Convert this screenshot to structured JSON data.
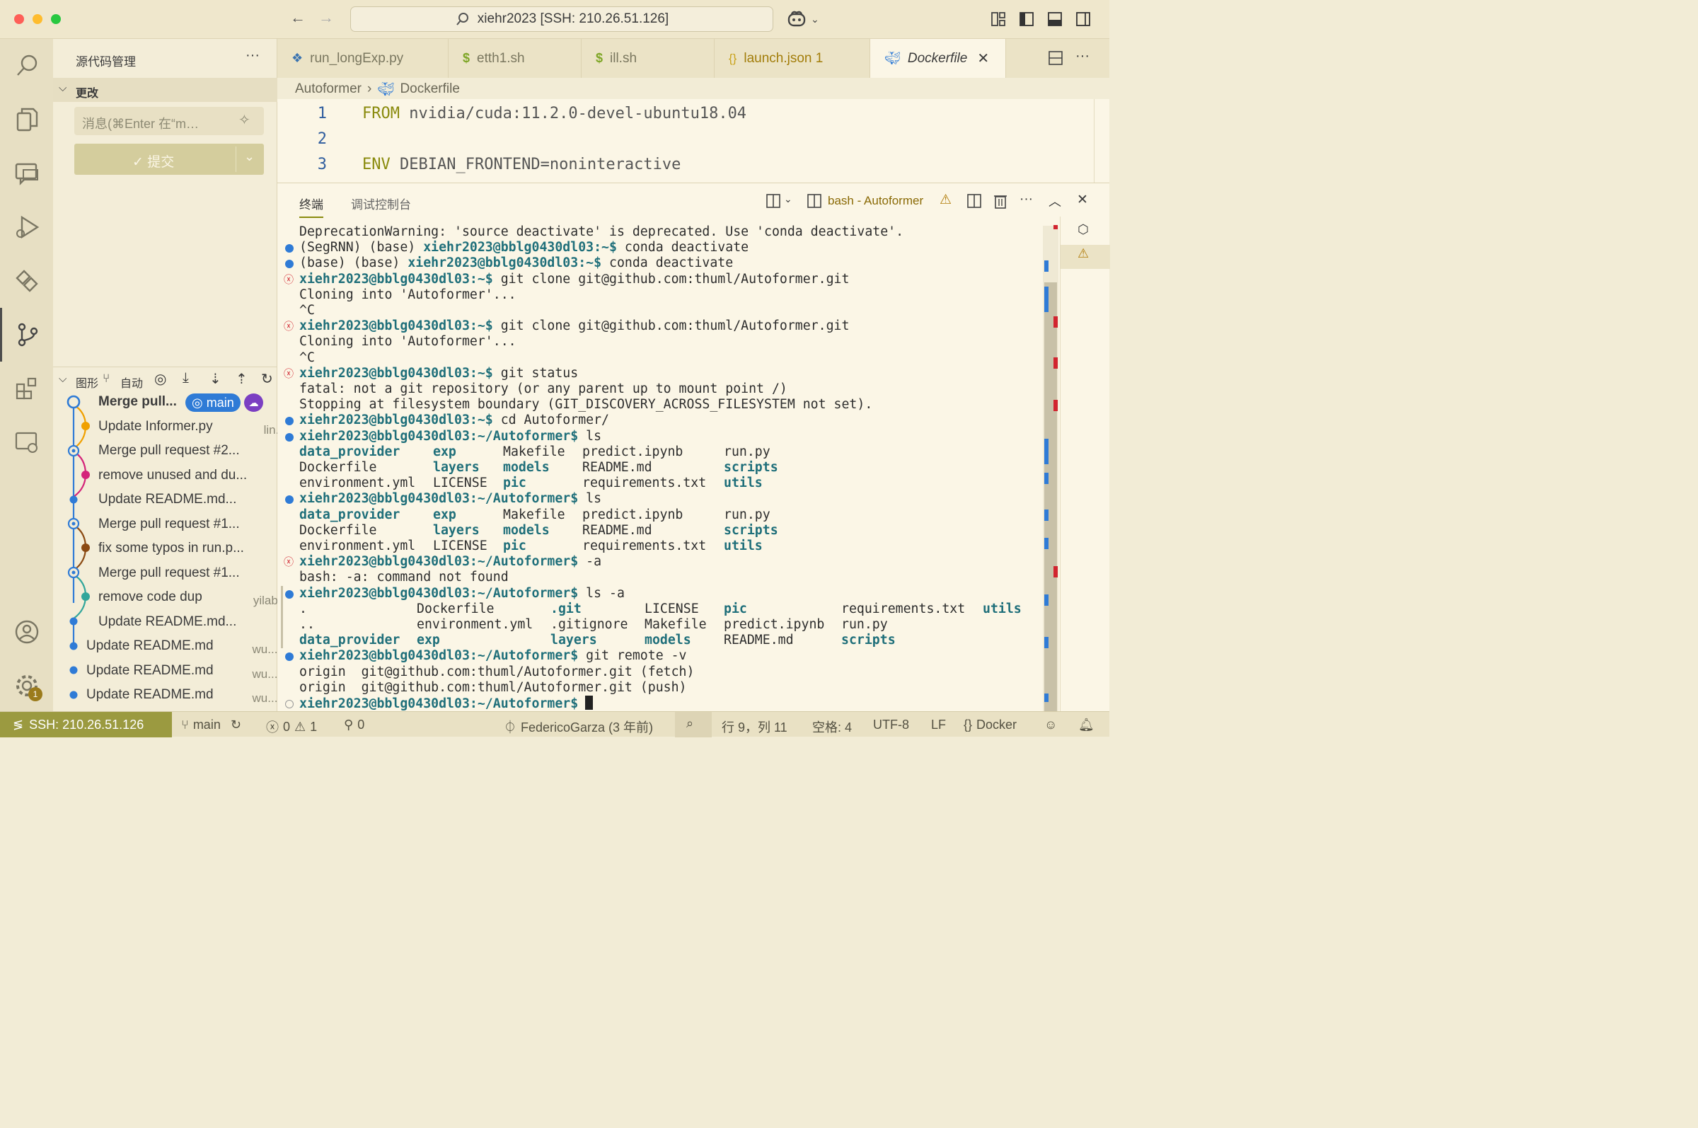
{
  "titlebar": {
    "command_center": "xiehr2023 [SSH: 210.26.51.126]"
  },
  "sidebar": {
    "title": "源代码管理",
    "changes_label": "更改",
    "message_placeholder": "消息(⌘Enter 在“m…",
    "commit_label": "✓ 提交",
    "graph_label": "图形",
    "auto_label": "自动",
    "commits": [
      {
        "msg": "Merge pull...",
        "author": "",
        "bold": true,
        "badge": "main"
      },
      {
        "msg": "Update Informer.py",
        "author": "lin..."
      },
      {
        "msg": "Merge pull request #2...",
        "author": ""
      },
      {
        "msg": "remove unused and du...",
        "author": ""
      },
      {
        "msg": "Update README.md...",
        "author": ""
      },
      {
        "msg": "Merge pull request #1...",
        "author": ""
      },
      {
        "msg": "fix some typos in run.p...",
        "author": ""
      },
      {
        "msg": "Merge pull request #1...",
        "author": ""
      },
      {
        "msg": "remove code dup",
        "author": "yilabs"
      },
      {
        "msg": "Update README.md...",
        "author": ""
      },
      {
        "msg": "Update README.md",
        "author": "wu..."
      },
      {
        "msg": "Update README.md",
        "author": "wu..."
      },
      {
        "msg": "Update README.md",
        "author": "wu..."
      }
    ],
    "settings_badge": "1"
  },
  "tabs": [
    {
      "label": "run_longExp.py",
      "icon": "python-icon"
    },
    {
      "label": "etth1.sh",
      "icon": "shell-icon"
    },
    {
      "label": "ill.sh",
      "icon": "shell-icon"
    },
    {
      "label": "launch.json 1",
      "icon": "json-icon"
    },
    {
      "label": "Dockerfile",
      "icon": "docker-icon"
    }
  ],
  "breadcrumb": {
    "folder": "Autoformer",
    "file": "Dockerfile"
  },
  "editor": {
    "lines": [
      {
        "num": "1",
        "kw": "FROM",
        "rest": " nvidia/cuda:11.2.0-devel-ubuntu18.04"
      },
      {
        "num": "2",
        "kw": "",
        "rest": ""
      },
      {
        "num": "3",
        "kw": "ENV",
        "rest": " DEBIAN_FRONTEND=noninteractive"
      }
    ]
  },
  "panel": {
    "tab_terminal": "终端",
    "tab_debug": "调试控制台",
    "terminal_name": "bash - Autoformer"
  },
  "terminal": {
    "prompt_home": "xiehr2023@bblg0430dl03:~$",
    "prompt_af": "xiehr2023@bblg0430dl03:~/Autoformer$",
    "l01": "DeprecationWarning: 'source deactivate' is deprecated. Use 'conda deactivate'.",
    "l02a": "(SegRNN) (base) ",
    "l02c": " conda deactivate",
    "l03a": "(base) (base) ",
    "l03c": " conda deactivate",
    "l04c": " git clone git@github.com:thuml/Autoformer.git",
    "l05": "Cloning into 'Autoformer'...",
    "l06": "^C",
    "l07c": " git clone git@github.com:thuml/Autoformer.git",
    "l08": "Cloning into 'Autoformer'...",
    "l09": "^C",
    "l10c": " git status",
    "l11": "fatal: not a git repository (or any parent up to mount point /)",
    "l12": "Stopping at filesystem boundary (GIT_DISCOVERY_ACROSS_FILESYSTEM not set).",
    "l13c": " cd Autoformer/",
    "l14c": " ls",
    "ls1": [
      [
        "data_provider",
        "exp",
        "Makefile",
        "predict.ipynb",
        "run.py"
      ],
      [
        "Dockerfile",
        "layers",
        "models",
        "README.md",
        "scripts"
      ],
      [
        "environment.yml",
        "LICENSE",
        "pic",
        "requirements.txt",
        "utils"
      ]
    ],
    "l18c": " ls",
    "l22c": " -a",
    "l23": "bash: -a: command not found",
    "l24c": " ls -a",
    "lsa": [
      [
        ".",
        "Dockerfile",
        ".git",
        "LICENSE",
        "pic",
        "requirements.txt",
        "utils"
      ],
      [
        "..",
        "environment.yml",
        ".gitignore",
        "Makefile",
        "predict.ipynb",
        "run.py",
        ""
      ],
      [
        "data_provider",
        "exp",
        "layers",
        "models",
        "README.md",
        "scripts",
        ""
      ]
    ],
    "l28c": " git remote -v",
    "l29": "origin  git@github.com:thuml/Autoformer.git (fetch)",
    "l30": "origin  git@github.com:thuml/Autoformer.git (push)"
  },
  "statusbar": {
    "remote": "SSH: 210.26.51.126",
    "branch": "main",
    "errors": "0",
    "warnings": "1",
    "ports": "0",
    "blame": "FedericoGarza (3 年前)",
    "position": "行 9，列 11",
    "spaces": "空格: 4",
    "encoding": "UTF-8",
    "eol": "LF",
    "language": "Docker"
  },
  "colors": {
    "accent": "#9b9a40",
    "prompt": "#1f6f7a",
    "error": "#d1242f",
    "blue": "#2f7bd6"
  }
}
